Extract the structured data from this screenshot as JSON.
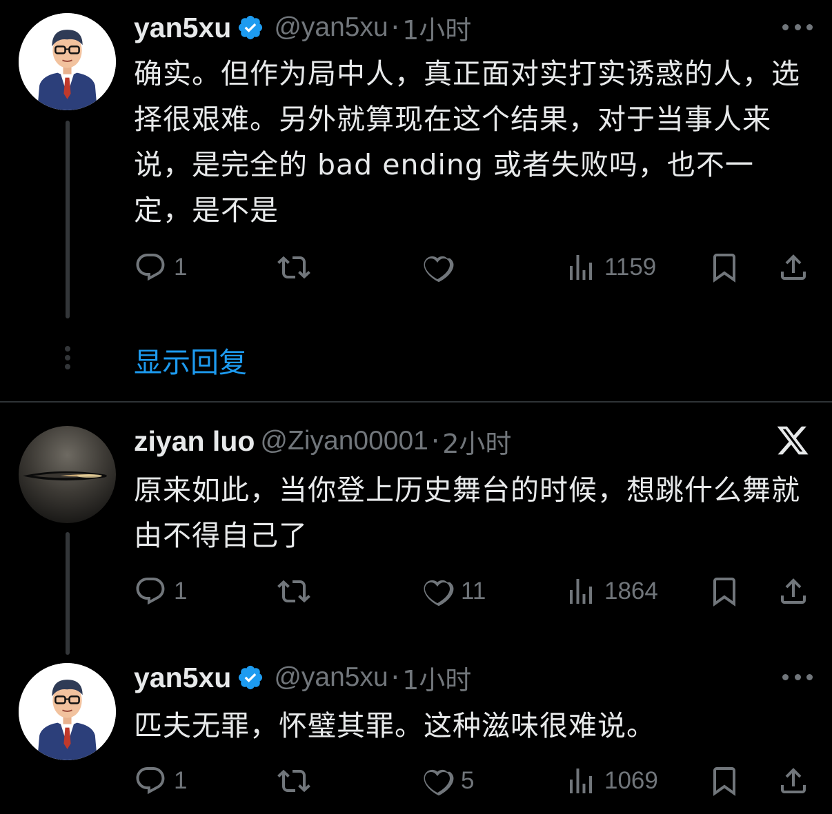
{
  "show_replies_label": "显示回复",
  "tweets": [
    {
      "name": "yan5xu",
      "handle": "@yan5xu",
      "dot": "·",
      "time": "1小时",
      "text": "确实。但作为局中人，真正面对实打实诱惑的人，选择很艰难。另外就算现在这个结果，对于当事人来说，是完全的 bad ending 或者失败吗，也不一定，是不是",
      "replies": "1",
      "retweets": "",
      "likes": "",
      "views": "1159"
    },
    {
      "name": "ziyan luo",
      "handle": "@Ziyan00001",
      "dot": "·",
      "time": "2小时",
      "text": "原来如此，当你登上历史舞台的时候，想跳什么舞就由不得自己了",
      "replies": "1",
      "retweets": "",
      "likes": "11",
      "views": "1864"
    },
    {
      "name": "yan5xu",
      "handle": "@yan5xu",
      "dot": "·",
      "time": "1小时",
      "text": "匹夫无罪，怀璧其罪。这种滋味很难说。",
      "replies": "1",
      "retweets": "",
      "likes": "5",
      "views": "1069"
    }
  ],
  "colors": {
    "background": "#000000",
    "text_primary": "#e7e9ea",
    "text_secondary": "#71767b",
    "accent": "#1d9bf0",
    "thread_line": "#333639"
  },
  "icons": [
    "verified-badge-icon",
    "more-icon",
    "reply-icon",
    "retweet-icon",
    "like-icon",
    "views-icon",
    "bookmark-icon",
    "share-icon",
    "x-logo-icon"
  ]
}
